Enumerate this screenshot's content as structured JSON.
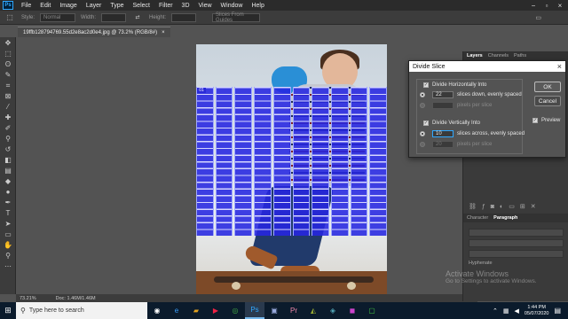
{
  "menubar": {
    "logo": "Ps",
    "items": [
      "File",
      "Edit",
      "Image",
      "Layer",
      "Type",
      "Select",
      "Filter",
      "3D",
      "View",
      "Window",
      "Help"
    ]
  },
  "options": {
    "style_label": "Style:",
    "style_value": "Normal",
    "width_label": "Width:",
    "height_label": "Height:",
    "slices_button": "Slices From Guides"
  },
  "document": {
    "tab_title": "19ffb128794769.55d2e8ac2d0e4.jpg @ 73.2% (RGB/8#)",
    "tab_close": "×",
    "zoom": "73.21%",
    "doc_size": "Doc: 1.46M/1.46M",
    "slice_badge": "01"
  },
  "panels": {
    "top_tabs": [
      "Layers",
      "Channels",
      "Paths"
    ],
    "bottom_tabs": [
      "Character",
      "Paragraph"
    ],
    "hyphenate": "Hyphenate"
  },
  "dialog": {
    "title": "Divide Slice",
    "close": "×",
    "horizontal": {
      "label": "Divide Horizontally Into",
      "checked": "✓",
      "count": "22",
      "count_suffix": "slices down, evenly spaced",
      "pixels_suffix": "pixels per slice"
    },
    "vertical": {
      "label": "Divide Vertically Into",
      "checked": "✓",
      "count": "10",
      "count_suffix": "slices across, evenly spaced",
      "pixels_value": "20",
      "pixels_suffix": "pixels per slice"
    },
    "ok_label": "OK",
    "cancel_label": "Cancel",
    "preview_label": "Preview",
    "preview_checked": "✓"
  },
  "watermark": {
    "line1": "Activate Windows",
    "line2": "Go to Settings to activate Windows."
  },
  "taskbar": {
    "search_placeholder": "Type here to search",
    "time": "1:44 PM",
    "date": "05/07/2020"
  },
  "colors": {
    "slice_fill": "#2626e1",
    "foreground_swatch": "#1b1ba8",
    "taskbar_bg": "#0b1b2c"
  }
}
